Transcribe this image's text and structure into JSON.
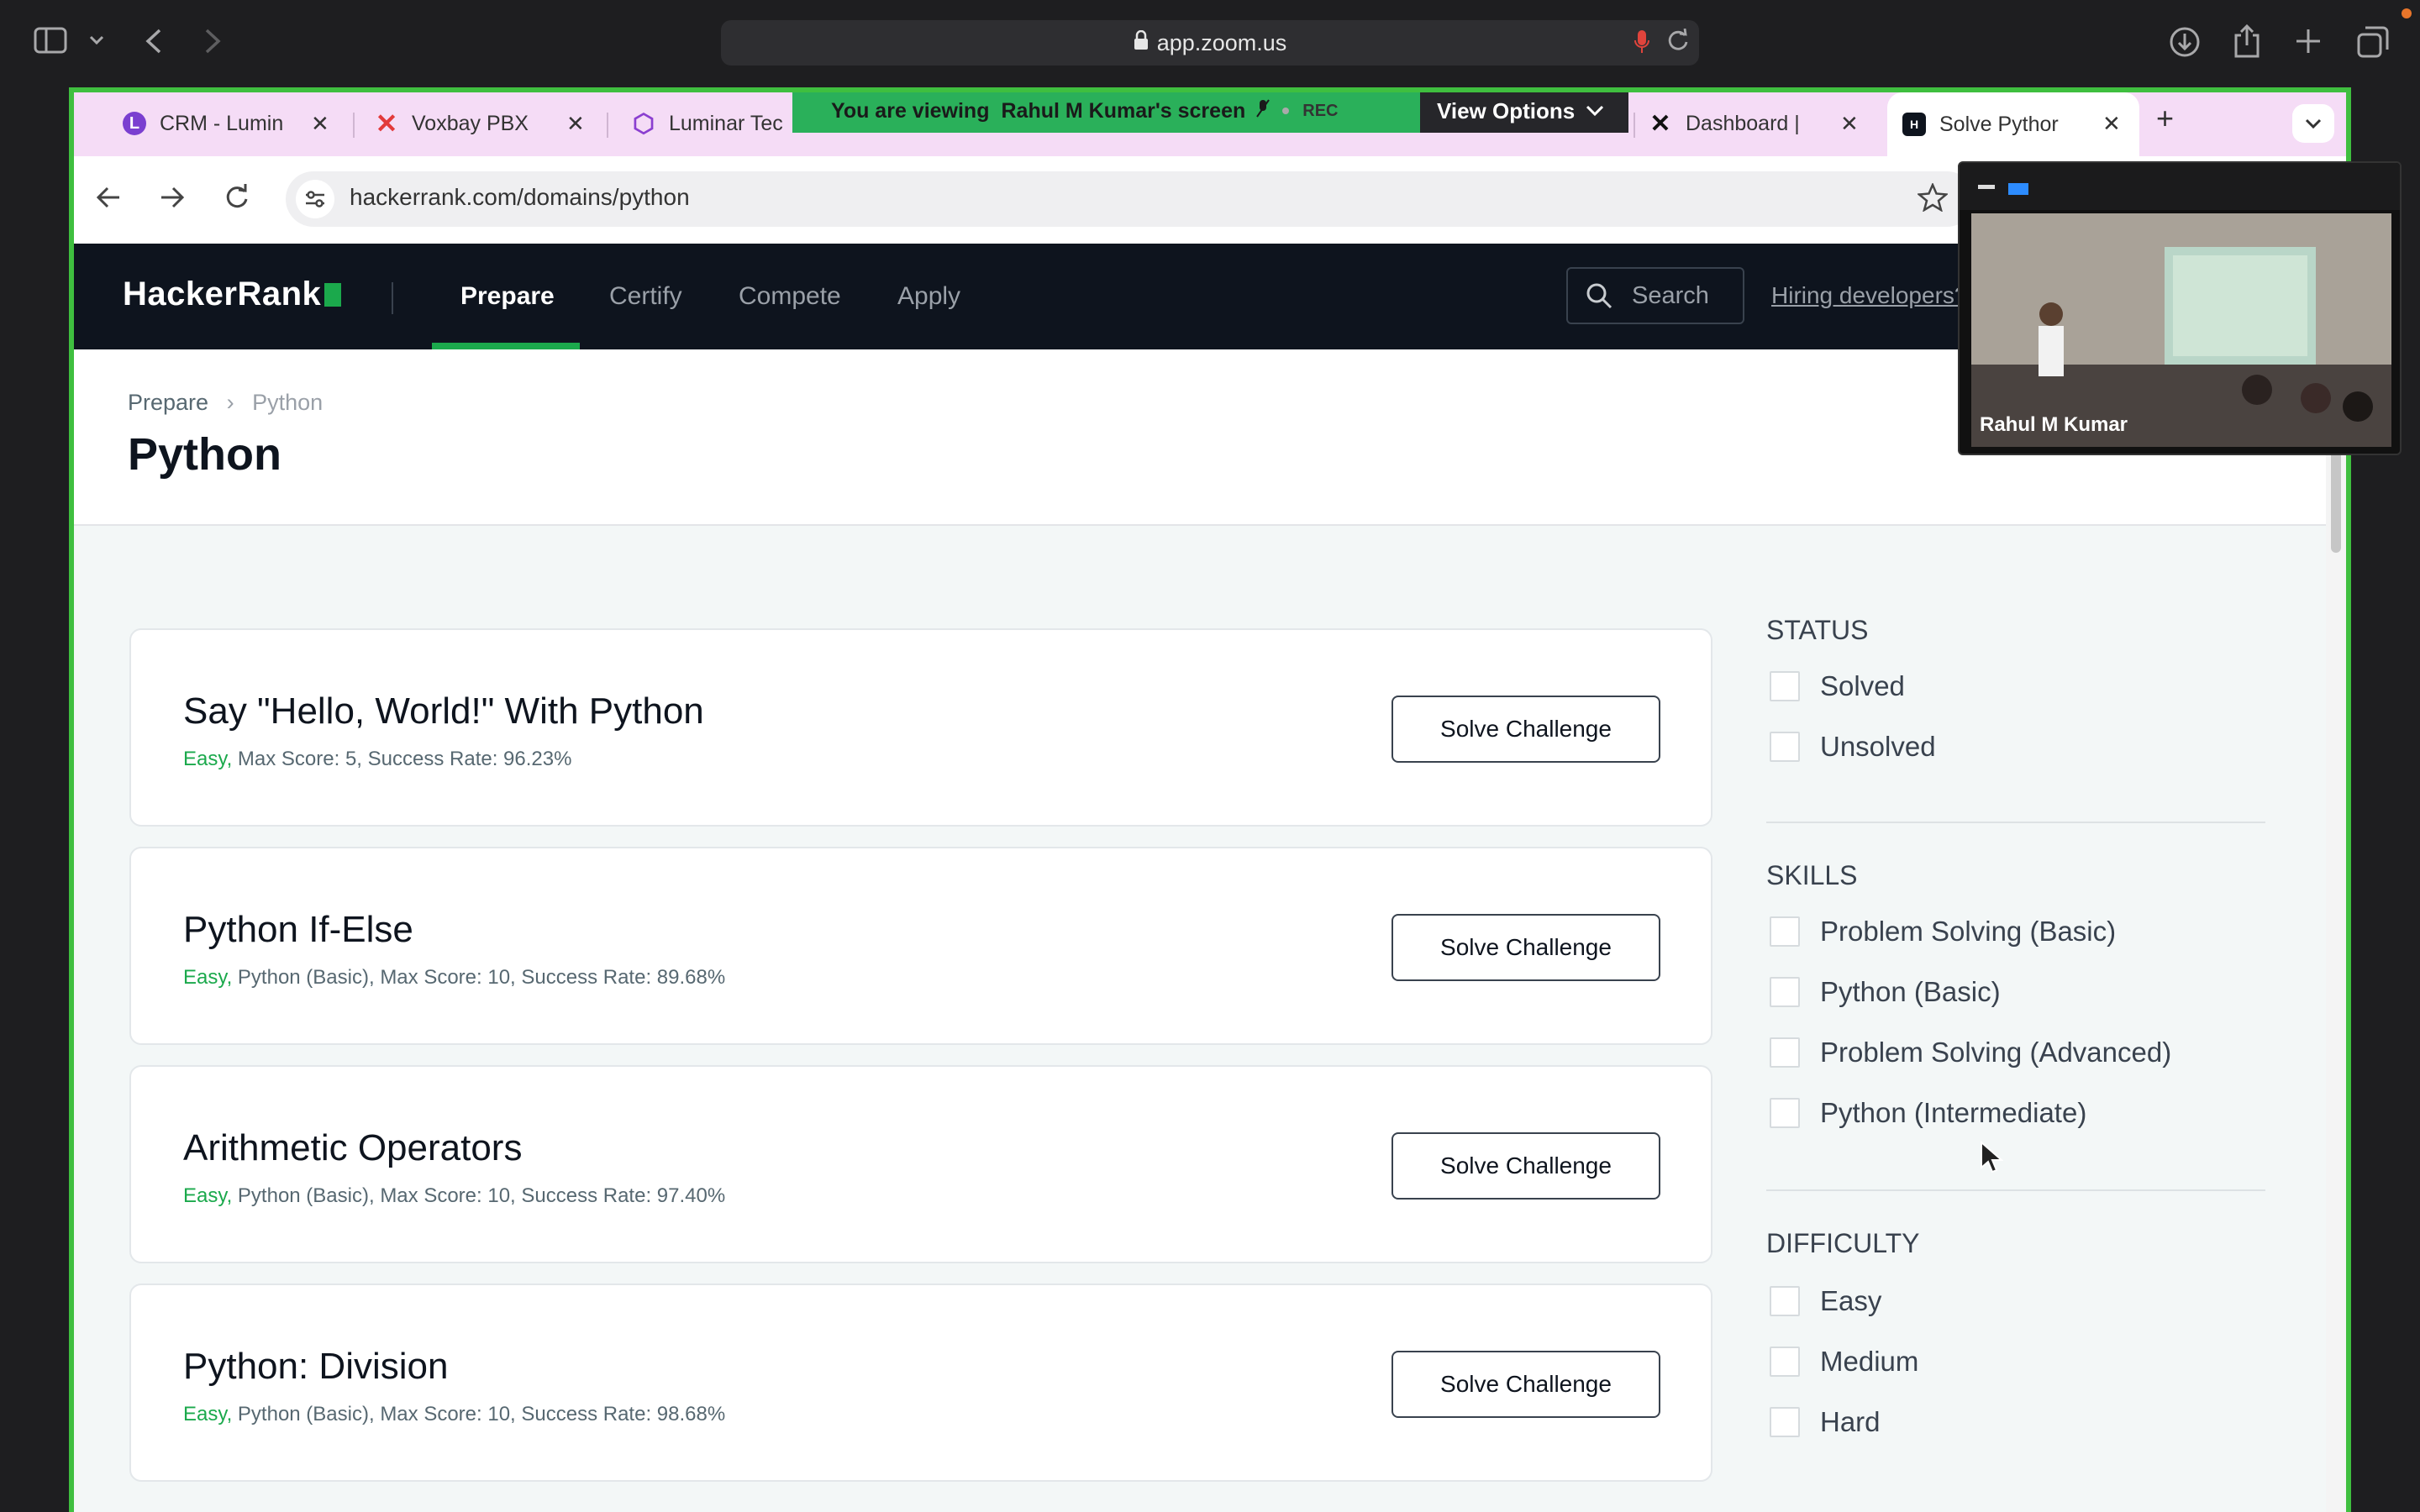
{
  "safari": {
    "address": "app.zoom.us",
    "colors": {
      "bar": "#1e1e20",
      "address_bg": "#2e2e31",
      "mic": "#e0443c"
    }
  },
  "zoom": {
    "banner_prefix": "You are viewing",
    "banner_name": "Rahul M Kumar's screen",
    "rec": "REC",
    "view_options": "View Options",
    "participant": "Rahul M Kumar",
    "frame_color": "#3fbf3f",
    "banner_color": "#2ab05a"
  },
  "browser": {
    "tabs": [
      {
        "title": "CRM - Lumin",
        "icon": "luminar-icon"
      },
      {
        "title": "Voxbay PBX",
        "icon": "voxbay-x-icon"
      },
      {
        "title": "Luminar Tec",
        "icon": "luminar-hex-icon"
      },
      {
        "title": "Dashboard |",
        "icon": "x-logo-icon"
      },
      {
        "title": "Solve Pythor",
        "icon": "hackerrank-icon",
        "active": true
      }
    ],
    "url": "hackerrank.com/domains/python",
    "tabstrip_color": "#f5dcf6"
  },
  "hackerrank": {
    "logo": "HackerRank",
    "nav": [
      "Prepare",
      "Certify",
      "Compete",
      "Apply"
    ],
    "active_nav": "Prepare",
    "search_label": "Search",
    "hiring_link": "Hiring developers?",
    "breadcrumb": {
      "root": "Prepare",
      "current": "Python"
    },
    "page_title": "Python",
    "brand_green": "#1ba94c",
    "nav_bg": "#0e141e"
  },
  "challenges": [
    {
      "title": "Say \"Hello, World!\" With Python",
      "difficulty": "Easy,",
      "meta": " Max Score: 5, Success Rate: 96.23%",
      "button": "Solve Challenge"
    },
    {
      "title": "Python If-Else",
      "difficulty": "Easy,",
      "meta": " Python (Basic), Max Score: 10, Success Rate: 89.68%",
      "button": "Solve Challenge"
    },
    {
      "title": "Arithmetic Operators",
      "difficulty": "Easy,",
      "meta": " Python (Basic), Max Score: 10, Success Rate: 97.40%",
      "button": "Solve Challenge"
    },
    {
      "title": "Python: Division",
      "difficulty": "Easy,",
      "meta": " Python (Basic), Max Score: 10, Success Rate: 98.68%",
      "button": "Solve Challenge"
    }
  ],
  "filters": {
    "status": {
      "heading": "STATUS",
      "options": [
        "Solved",
        "Unsolved"
      ]
    },
    "skills": {
      "heading": "SKILLS",
      "options": [
        "Problem Solving (Basic)",
        "Python (Basic)",
        "Problem Solving (Advanced)",
        "Python (Intermediate)"
      ]
    },
    "difficulty": {
      "heading": "DIFFICULTY",
      "options": [
        "Easy",
        "Medium",
        "Hard"
      ]
    }
  }
}
